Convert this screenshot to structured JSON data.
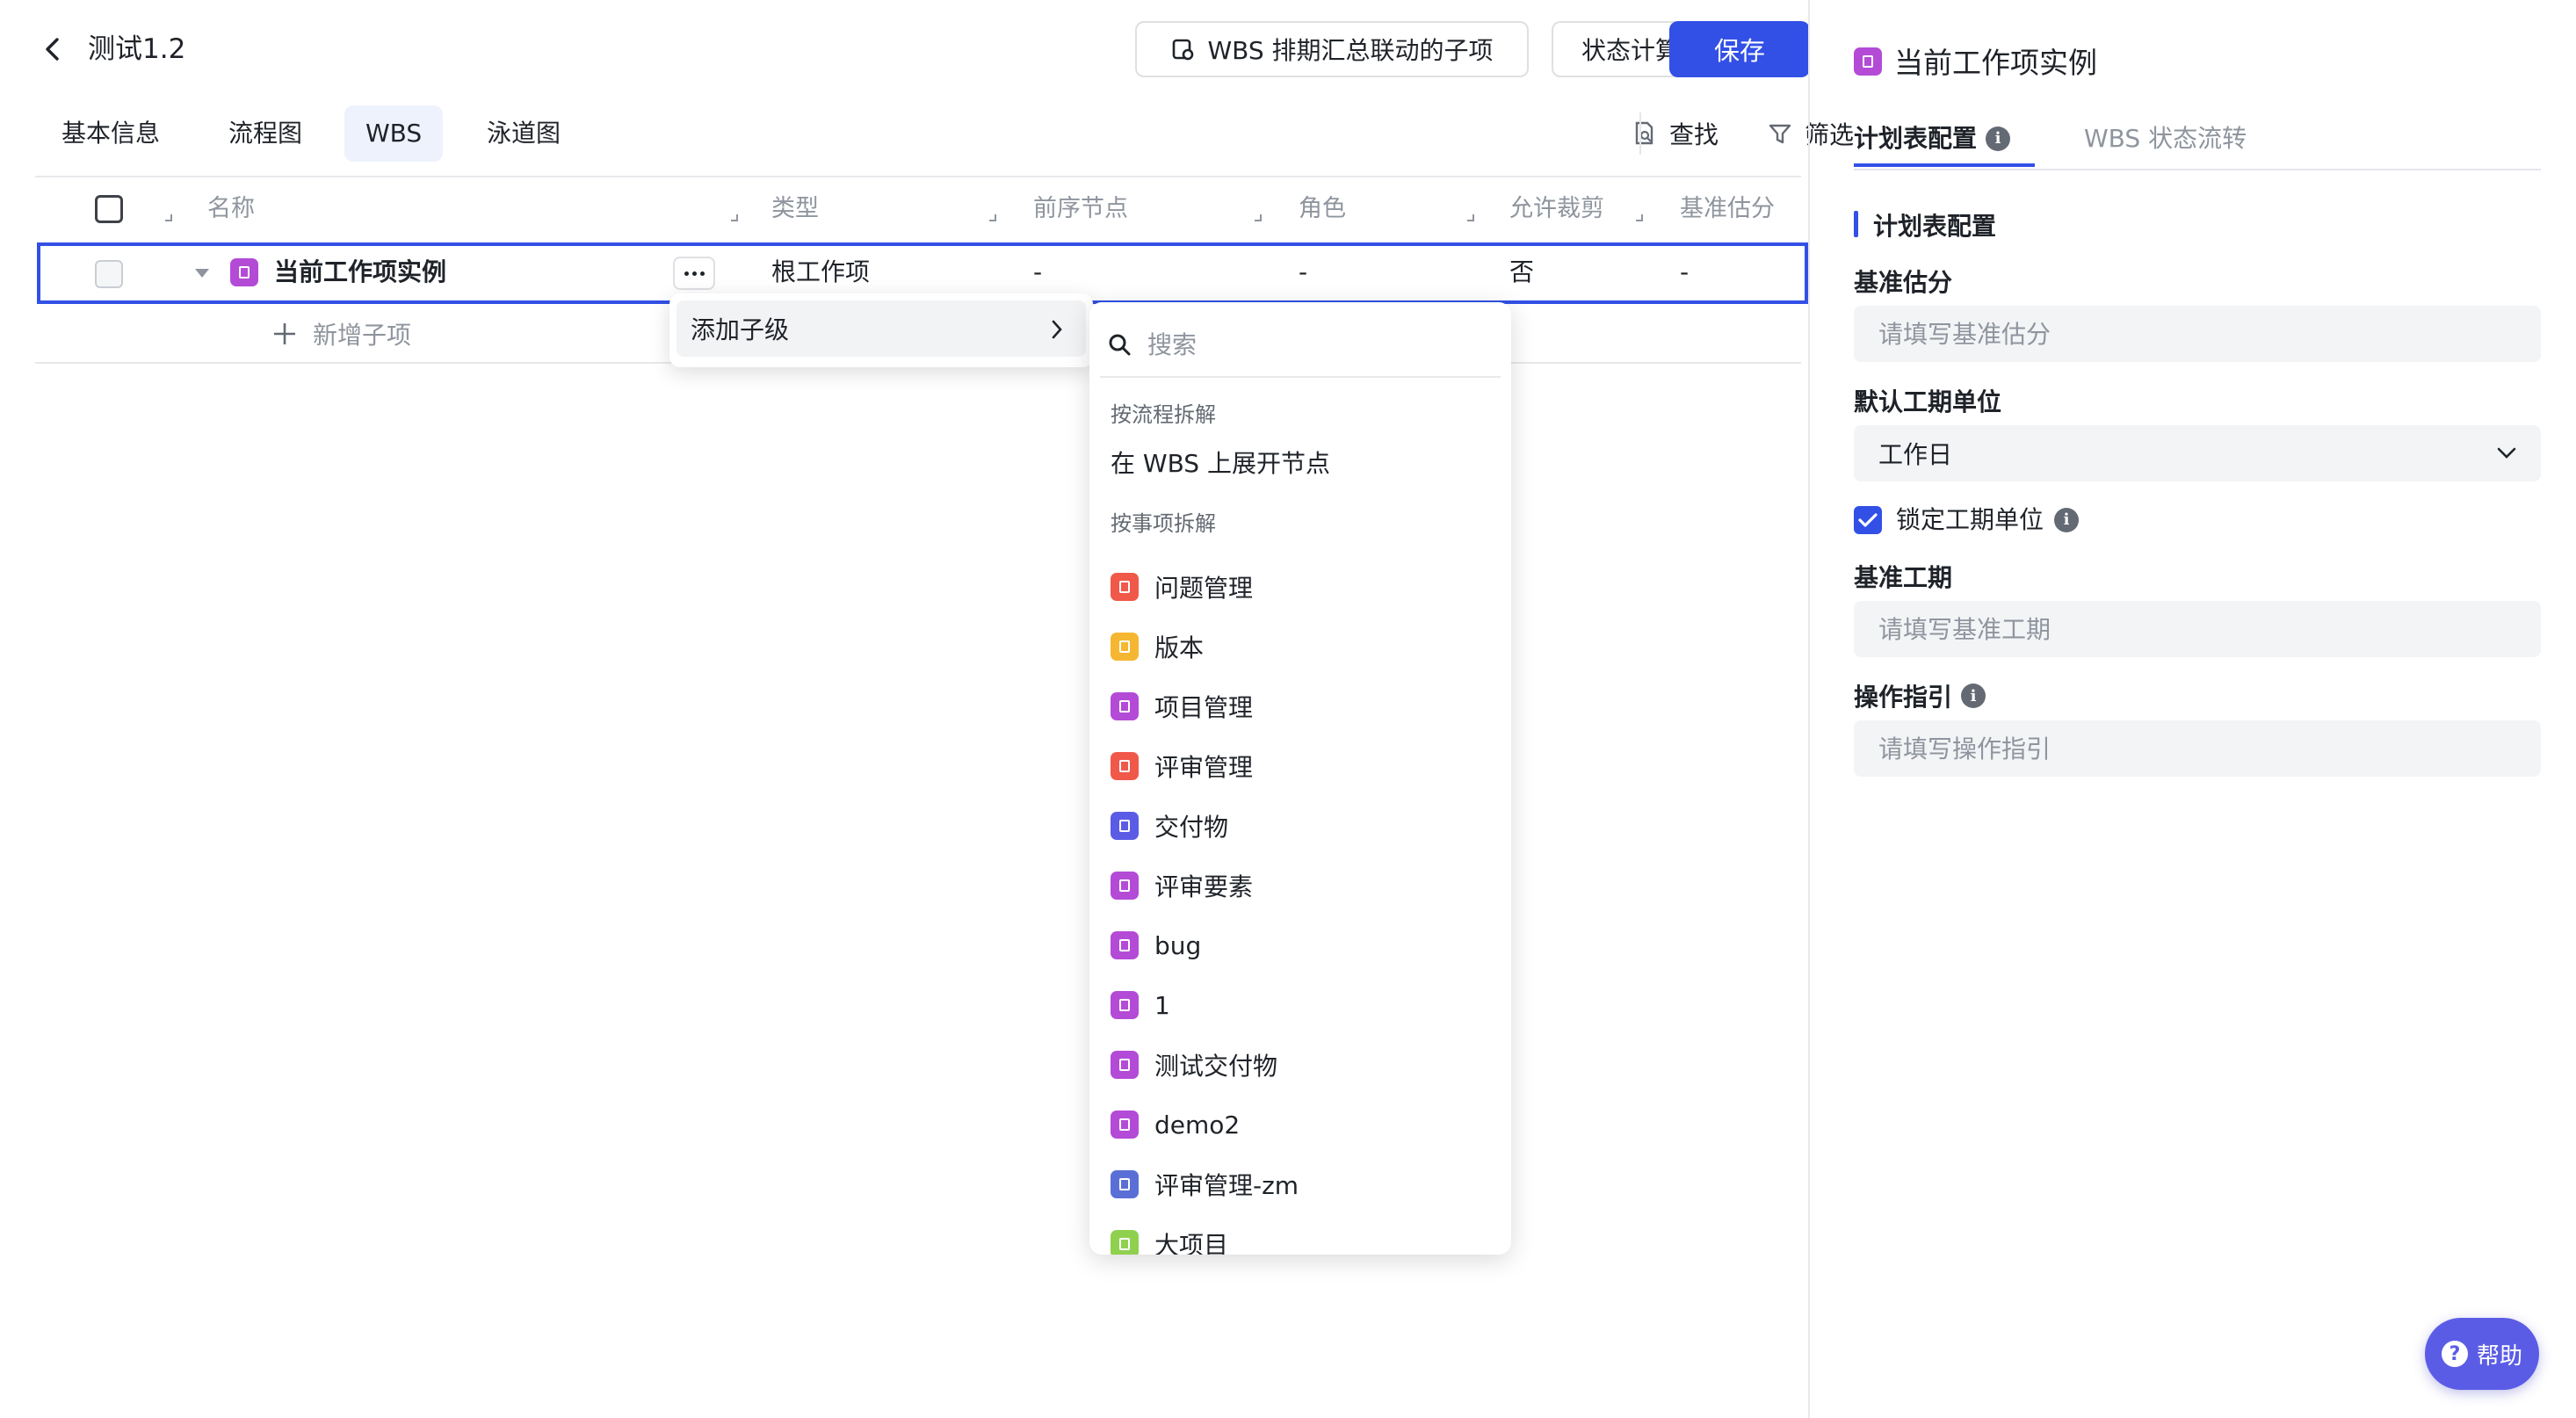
{
  "header": {
    "title": "测试1.2",
    "wbs_button_label": "WBS 排期汇总联动的子项",
    "status_rule_label": "状态计算规则",
    "save_label": "保存"
  },
  "tabs": [
    {
      "label": "基本信息"
    },
    {
      "label": "流程图"
    },
    {
      "label": "WBS"
    },
    {
      "label": "泳道图"
    }
  ],
  "toolbar": {
    "find_label": "查找",
    "filter_label": "筛选"
  },
  "table": {
    "columns": [
      "名称",
      "类型",
      "前序节点",
      "角色",
      "允许裁剪",
      "基准估分"
    ],
    "row": {
      "name": "当前工作项实例",
      "type": "根工作项",
      "predecessor": "-",
      "role": "-",
      "allow_cut": "否",
      "baseline": "-"
    },
    "add_child_label": "新增子项"
  },
  "context_menu": {
    "add_child_label": "添加子级"
  },
  "submenu": {
    "search_placeholder": "搜索",
    "group_process": "按流程拆解",
    "expand_node_label": "在 WBS 上展开节点",
    "group_items": "按事项拆解",
    "items": [
      {
        "label": "问题管理",
        "color": "#f0584a"
      },
      {
        "label": "版本",
        "color": "#f5b731"
      },
      {
        "label": "项目管理",
        "color": "#b34bd6"
      },
      {
        "label": "评审管理",
        "color": "#f0584a"
      },
      {
        "label": "交付物",
        "color": "#5b5ce6"
      },
      {
        "label": "评审要素",
        "color": "#b34bd6"
      },
      {
        "label": "bug",
        "color": "#b34bd6"
      },
      {
        "label": "1",
        "color": "#b34bd6"
      },
      {
        "label": "测试交付物",
        "color": "#b34bd6"
      },
      {
        "label": "demo2",
        "color": "#b34bd6"
      },
      {
        "label": "评审管理-zm",
        "color": "#5a6fd6"
      },
      {
        "label": "大项目",
        "color": "#8fd14f"
      }
    ]
  },
  "panel": {
    "title": "当前工作项实例",
    "tab_plan": "计划表配置",
    "tab_wbs_flow": "WBS 状态流转",
    "section_title": "计划表配置",
    "baseline_label": "基准估分",
    "baseline_placeholder": "请填写基准估分",
    "unit_label": "默认工期单位",
    "unit_value": "工作日",
    "lock_label": "锁定工期单位",
    "duration_label": "基准工期",
    "duration_placeholder": "请填写基准工期",
    "guide_label": "操作指引",
    "guide_placeholder": "请填写操作指引"
  },
  "help": {
    "label": "帮助"
  },
  "colors": {
    "accent": "#3250e6",
    "item_purple": "#b34bd6"
  }
}
